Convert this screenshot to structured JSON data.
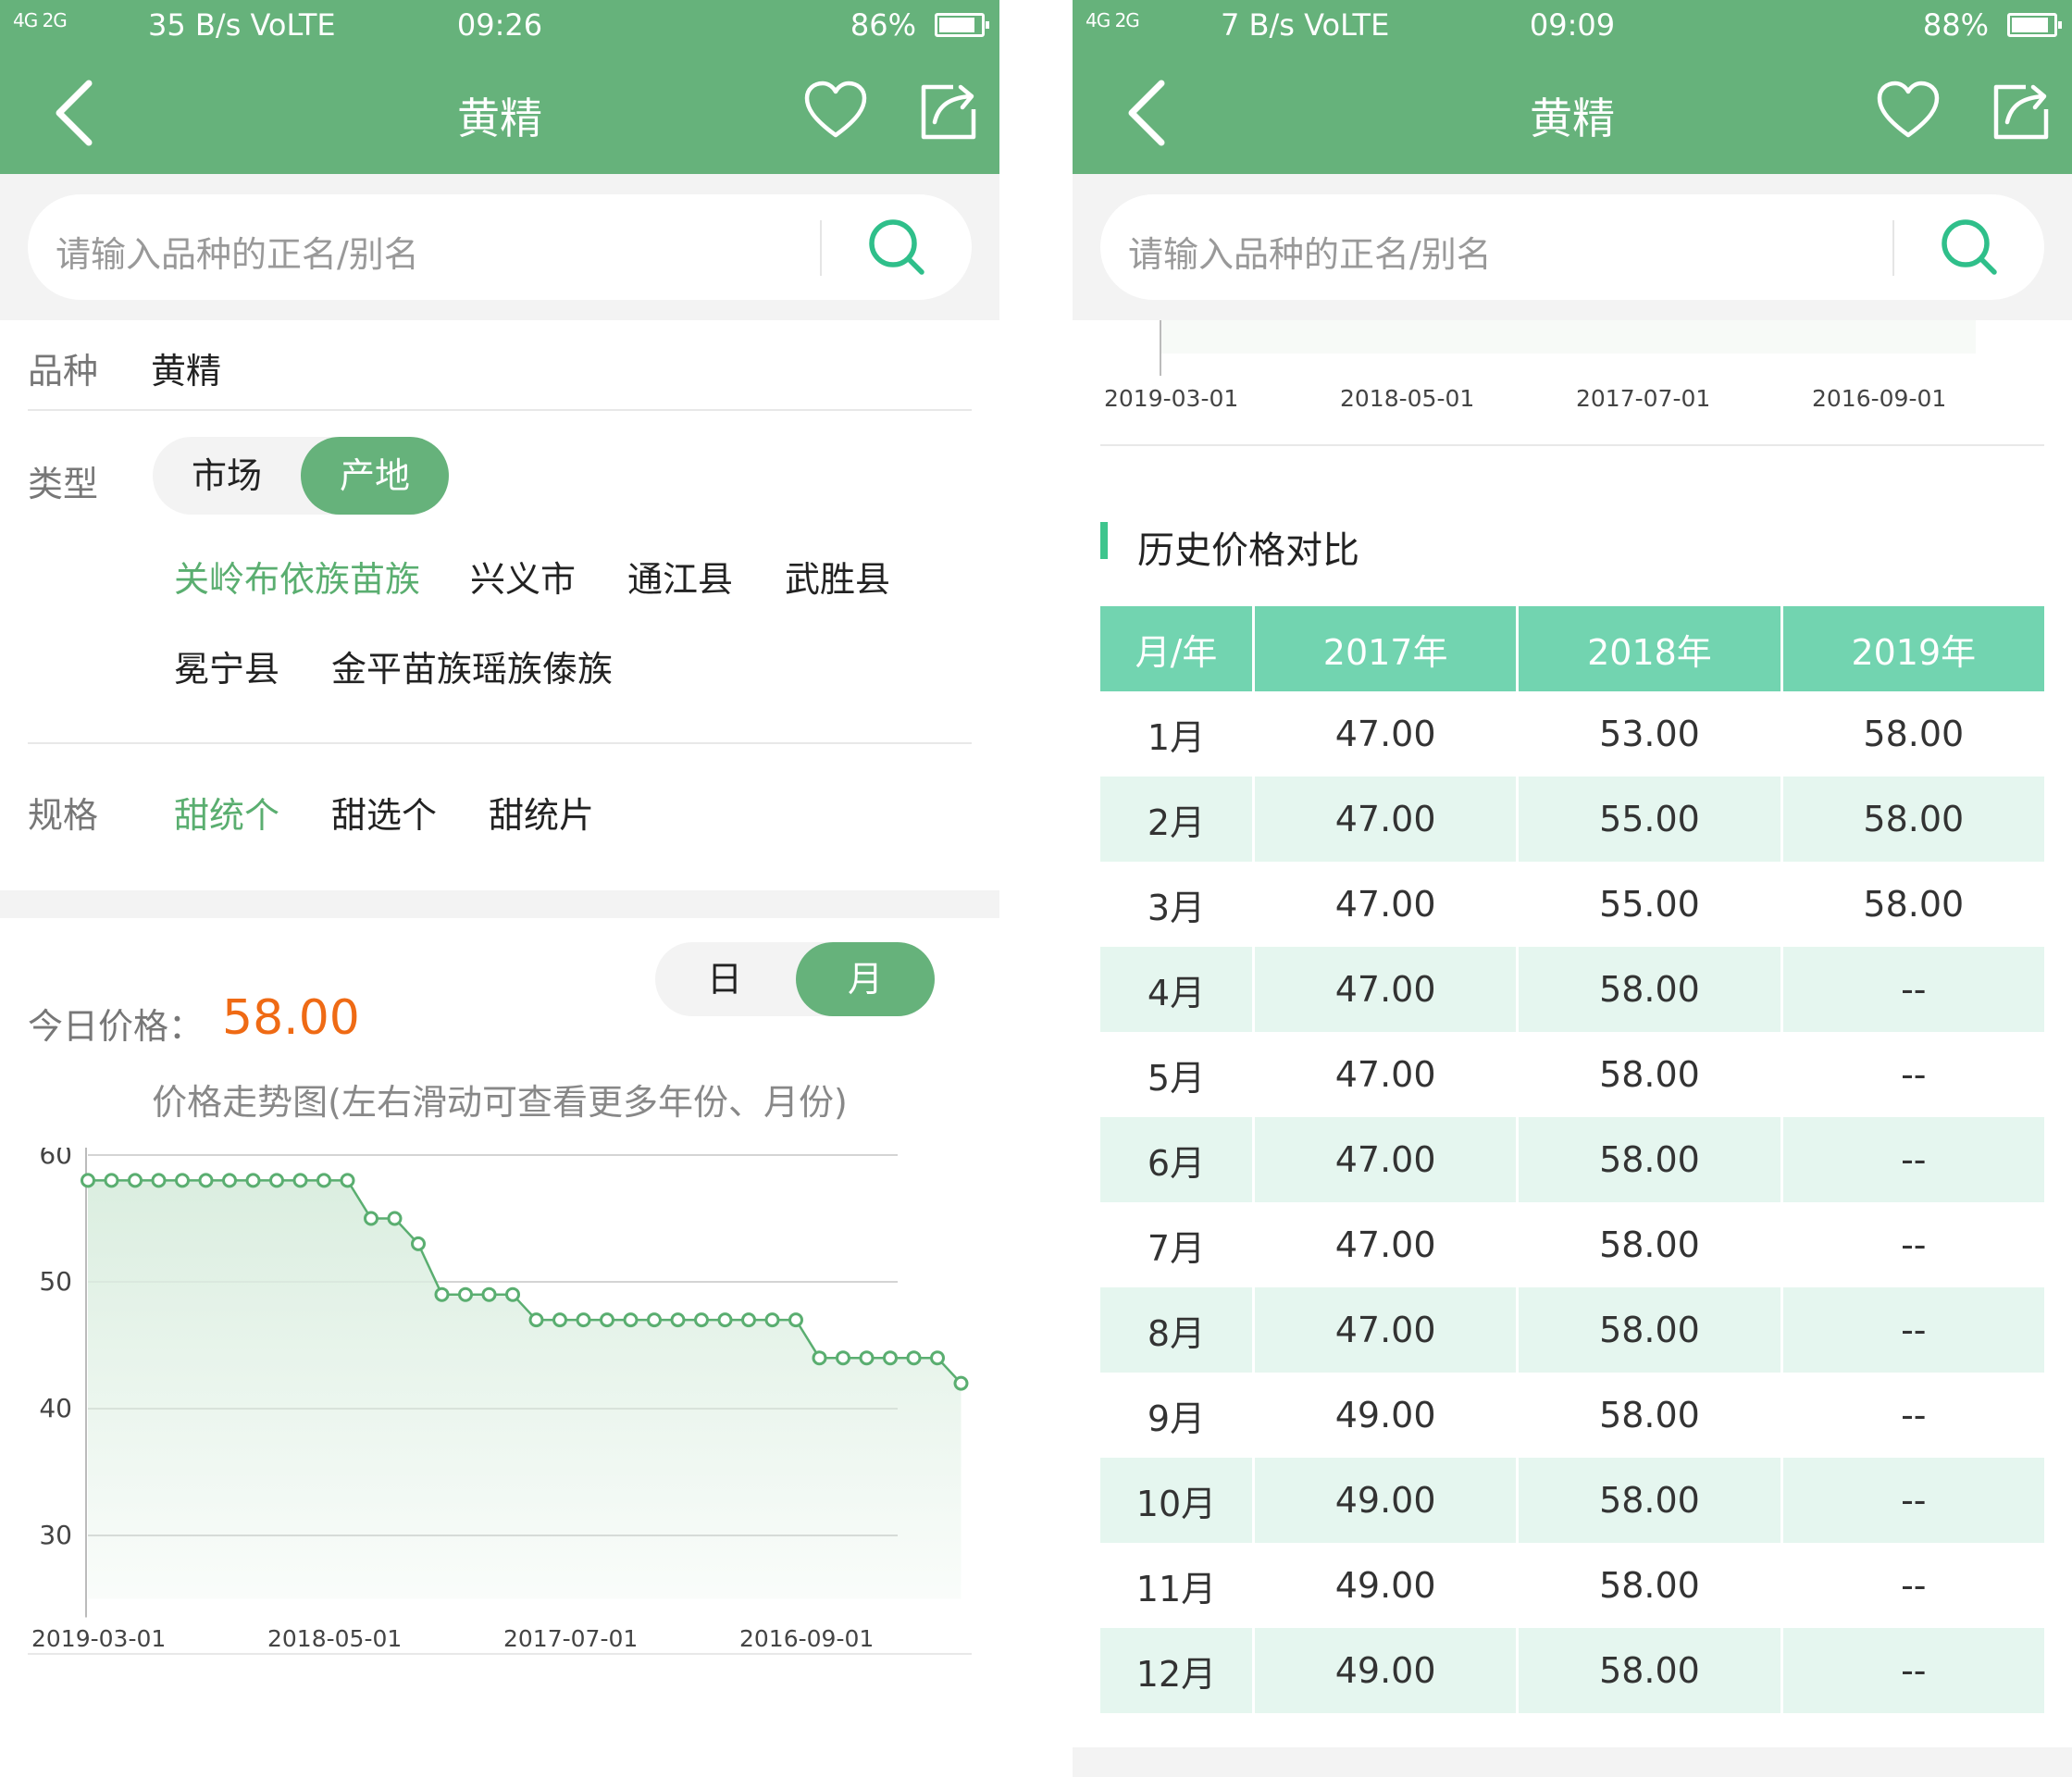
{
  "left": {
    "status": {
      "signal": "4G 2G",
      "speed": "35 B/s VoLTE",
      "time": "09:26",
      "battery": "86%",
      "battery_level": 0.86
    },
    "appbar": {
      "title": "黄精"
    },
    "search": {
      "placeholder": "请输入品种的正名/别名"
    },
    "variety": {
      "label": "品种",
      "value": "黄精"
    },
    "type": {
      "label": "类型",
      "options": [
        "市场",
        "产地"
      ],
      "active": 1
    },
    "origins": [
      {
        "label": "关岭布依族苗族",
        "active": true
      },
      {
        "label": "兴义市",
        "active": false
      },
      {
        "label": "通江县",
        "active": false
      },
      {
        "label": "武胜县",
        "active": false
      },
      {
        "label": "冕宁县",
        "active": false
      },
      {
        "label": "金平苗族瑶族傣族",
        "active": false
      }
    ],
    "spec": {
      "label": "规格",
      "options": [
        {
          "label": "甜统个",
          "active": true
        },
        {
          "label": "甜选个",
          "active": false
        },
        {
          "label": "甜统片",
          "active": false
        }
      ]
    },
    "today": {
      "label": "今日价格：",
      "value": "58.00"
    },
    "period": {
      "options": [
        "日",
        "月"
      ],
      "active": 1
    },
    "hint": "价格走势图(左右滑动可查看更多年份、月份)"
  },
  "chart_data": {
    "type": "area",
    "title": "",
    "xlabel": "",
    "ylabel": "",
    "ylim": [
      25,
      60
    ],
    "yticks": [
      60,
      50,
      40,
      30
    ],
    "x_tick_labels": [
      "2019-03-01",
      "2018-05-01",
      "2017-07-01",
      "2016-09-01"
    ],
    "x_order": "descending (newest on the left)",
    "grid": true,
    "color": "#5aae70",
    "fill": "#dbeee0",
    "series": [
      {
        "values": [
          58,
          58,
          58,
          58,
          58,
          58,
          58,
          58,
          58,
          58,
          58,
          58,
          55,
          55,
          53,
          49,
          49,
          49,
          49,
          47,
          47,
          47,
          47,
          47,
          47,
          47,
          47,
          47,
          47,
          47,
          47,
          44,
          44,
          44,
          44,
          44,
          44,
          42
        ]
      }
    ]
  },
  "right": {
    "status": {
      "signal": "4G 2G",
      "speed": "7 B/s VoLTE",
      "time": "09:09",
      "battery": "88%",
      "battery_level": 0.88
    },
    "appbar": {
      "title": "黄精"
    },
    "search": {
      "placeholder": "请输入品种的正名/别名"
    },
    "chart_tail_labels": [
      "2019-03-01",
      "2018-05-01",
      "2017-07-01",
      "2016-09-01"
    ],
    "section_title": "历史价格对比",
    "table": {
      "headers": [
        "月/年",
        "2017年",
        "2018年",
        "2019年"
      ],
      "rows": [
        [
          "1月",
          "47.00",
          "53.00",
          "58.00"
        ],
        [
          "2月",
          "47.00",
          "55.00",
          "58.00"
        ],
        [
          "3月",
          "47.00",
          "55.00",
          "58.00"
        ],
        [
          "4月",
          "47.00",
          "58.00",
          "--"
        ],
        [
          "5月",
          "47.00",
          "58.00",
          "--"
        ],
        [
          "6月",
          "47.00",
          "58.00",
          "--"
        ],
        [
          "7月",
          "47.00",
          "58.00",
          "--"
        ],
        [
          "8月",
          "47.00",
          "58.00",
          "--"
        ],
        [
          "9月",
          "49.00",
          "58.00",
          "--"
        ],
        [
          "10月",
          "49.00",
          "58.00",
          "--"
        ],
        [
          "11月",
          "49.00",
          "58.00",
          "--"
        ],
        [
          "12月",
          "49.00",
          "58.00",
          "--"
        ]
      ]
    }
  }
}
